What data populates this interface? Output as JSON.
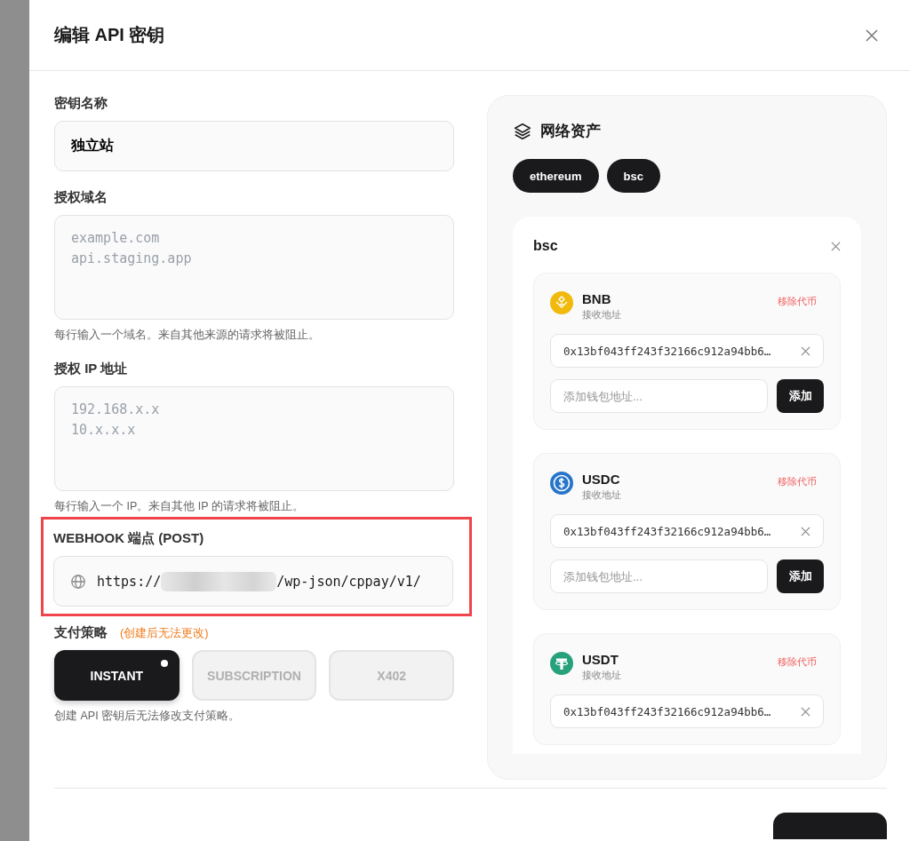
{
  "dialog": {
    "title": "编辑 API 密钥"
  },
  "fields": [
    {
      "kind": "input",
      "label": "密钥名称",
      "value": "独立站"
    },
    {
      "kind": "textarea",
      "label": "授权域名",
      "placeholder": "example.com\napi.staging.app",
      "help": "每行输入一个域名。来自其他来源的请求将被阻止。"
    },
    {
      "kind": "textarea",
      "label": "授权 IP 地址",
      "placeholder": "192.168.x.x\n10.x.x.x",
      "help": "每行输入一个 IP。来自其他 IP 的请求将被阻止。"
    },
    {
      "kind": "url",
      "label": "WEBHOOK 端点 (POST)",
      "value_start": "https://",
      "value_end": "/wp-json/cppay/v1/",
      "highlighted": true
    }
  ],
  "payment_strategy": {
    "label": "支付策略",
    "note": "(创建后无法更改)",
    "help": "创建 API 密钥后无法修改支付策略。",
    "options": [
      {
        "label": "INSTANT",
        "selected": true,
        "disabled": false
      },
      {
        "label": "SUBSCRIPTION",
        "selected": false,
        "disabled": true
      },
      {
        "label": "X402",
        "selected": false,
        "disabled": true
      }
    ]
  },
  "network_assets": {
    "title": "网络资产",
    "networks": [
      "ethereum",
      "bsc"
    ],
    "panel": {
      "network": "bsc",
      "tokens": [
        {
          "kind": "bnb",
          "symbol": "BNB",
          "sublabel": "接收地址",
          "remove": "移除代币",
          "address": "0x13bf043ff243f32166c912a94bb6…",
          "placeholder": "添加钱包地址...",
          "add_button": "添加"
        },
        {
          "kind": "usdc",
          "symbol": "USDC",
          "sublabel": "接收地址",
          "remove": "移除代币",
          "address": "0x13bf043ff243f32166c912a94bb6…",
          "placeholder": "添加钱包地址...",
          "add_button": "添加"
        },
        {
          "kind": "usdt",
          "symbol": "USDT",
          "sublabel": "接收地址",
          "remove": "移除代币",
          "address": "0x13bf043ff243f32166c912a94bb6…"
        }
      ]
    }
  }
}
